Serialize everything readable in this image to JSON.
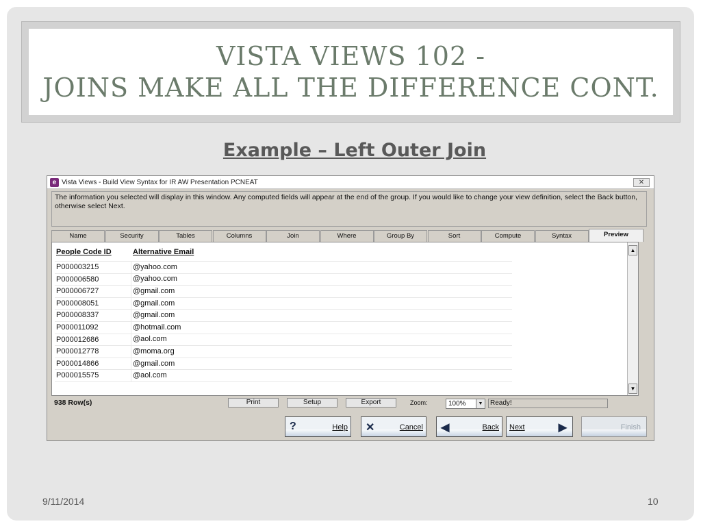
{
  "slide": {
    "title_line1": "Vista Views 102 -",
    "title_line2": "Joins Make All The Difference Cont.",
    "subtitle": "Example – Left Outer Join",
    "date": "9/11/2014",
    "page_number": "10"
  },
  "window": {
    "title": "Vista Views - Build View Syntax for IR AW Presentation PCNEAT",
    "close_glyph": "✕",
    "app_icon_letter": "e",
    "info_text": "The information you selected will display in this window.  Any computed fields will appear at the end of the group.  If you would like to change your view definition, select the Back button, otherwise select Next.",
    "tabs": [
      "Name",
      "Security",
      "Tables",
      "Columns",
      "Join",
      "Where",
      "Group By",
      "Sort",
      "Compute",
      "Syntax",
      "Preview"
    ],
    "active_tab": "Preview",
    "table": {
      "headers": [
        "People Code ID",
        "Alternative Email"
      ],
      "rows": [
        [
          "P000003215",
          "@yahoo.com"
        ],
        [
          "P000006580",
          "@yahoo.com"
        ],
        [
          "P000006727",
          "@gmail.com"
        ],
        [
          "P000008051",
          "@gmail.com"
        ],
        [
          "P000008337",
          "@gmail.com"
        ],
        [
          "P000011092",
          "@hotmail.com"
        ],
        [
          "P000012686",
          "@aol.com"
        ],
        [
          "P000012778",
          "@moma.org"
        ],
        [
          "P000014866",
          "@gmail.com"
        ],
        [
          "P000015575",
          "@aol.com"
        ]
      ]
    },
    "row_count": "938 Row(s)",
    "buttons": {
      "print": "Print",
      "setup": "Setup",
      "export": "Export"
    },
    "zoom_label": "Zoom:",
    "zoom_value": "100%",
    "status": "Ready!",
    "wizard": {
      "help": "Help",
      "cancel": "Cancel",
      "back": "Back",
      "next": "Next",
      "finish": "Finish"
    }
  },
  "colors": {
    "title": "#6b7b6b",
    "subtitle": "#595959",
    "window_bg": "#d4d0c8"
  }
}
